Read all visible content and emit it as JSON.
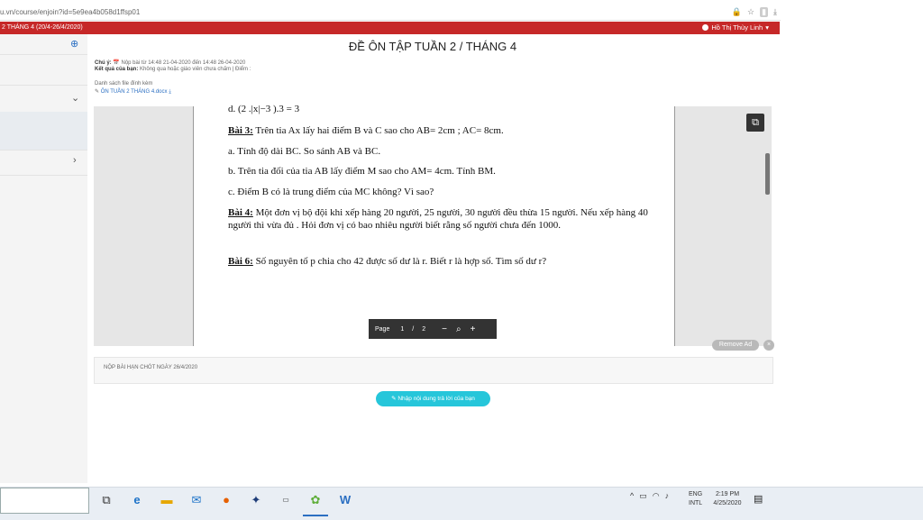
{
  "browser": {
    "url_prefix": "u.vn/course/enjoin?id=5e9ea4b058d1ffsp01",
    "icons": [
      "lock-icon",
      "star-icon",
      "extension-icon",
      "download-icon"
    ]
  },
  "course_bar": {
    "title": "2 THÁNG 4 (20/4-26/4/2020)",
    "user_name": "Hồ Thị Thùy Linh",
    "color": "#c62828"
  },
  "header": {
    "title": "ĐỀ ÔN TẬP TUẦN 2 / THÁNG 4",
    "note_label": "Chú ý:",
    "note_text": "Nộp bài từ 14:48 21-04-2020 đến 14:48 26-04-2020",
    "result_label": "Kết quả của bạn:",
    "result_text": "Không qua hoặc giáo viên chưa chấm  |  Điểm :",
    "attachments_label": "Danh sách file đính kèm",
    "attachment_file": "ÔN TUẦN 2 THÁNG 4.docx"
  },
  "document": {
    "top_cut_line": "d. (2 .|x|−3 ).3 = 3",
    "lines": [
      {
        "bold": "Bài 3:",
        "text": " Trên tia Ax lấy hai điểm B và C sao cho AB= 2cm ; AC= 8cm."
      },
      {
        "bold": "",
        "text": "a. Tính độ dài BC. So sánh AB và BC."
      },
      {
        "bold": "",
        "text": "b. Trên tia đối của tia AB lấy điểm M sao cho AM= 4cm. Tính BM."
      },
      {
        "bold": "",
        "text": "c. Điểm B có là trung điểm của MC không? Vì sao?"
      },
      {
        "bold": "Bài 4:",
        "text": " Một đơn vị bộ đội khi xếp hàng 20 người, 25 người, 30 người đều thừa 15 người. Nếu xếp hàng 40 người thì vừa đủ . Hỏi đơn vị có bao nhiêu người biết rằng số người chưa đến 1000."
      },
      {
        "bold": "Bài 6:",
        "text": " Số nguyên tố p chia cho 42 được số dư là r. Biết r là hợp số. Tìm số dư r?"
      }
    ],
    "pager": {
      "label": "Page",
      "current": "1",
      "separator": "/",
      "total": "2"
    }
  },
  "remove_ad_label": "Remove Ad",
  "deadline_text": "NỘP BÀI HẠN CHÓT NGÀY 26/4/2020",
  "answer_button": "Nhập nội dung trả lời của bạn",
  "taskbar": {
    "apps": [
      "task-view-icon",
      "edge-icon",
      "file-explorer-icon",
      "mail-icon",
      "firefox-icon",
      "dropbox-icon",
      "amazon-icon",
      "store-icon",
      "word-icon"
    ],
    "language_top": "ENG",
    "language_bottom": "INTL",
    "time": "2:19 PM",
    "date": "4/25/2020"
  }
}
